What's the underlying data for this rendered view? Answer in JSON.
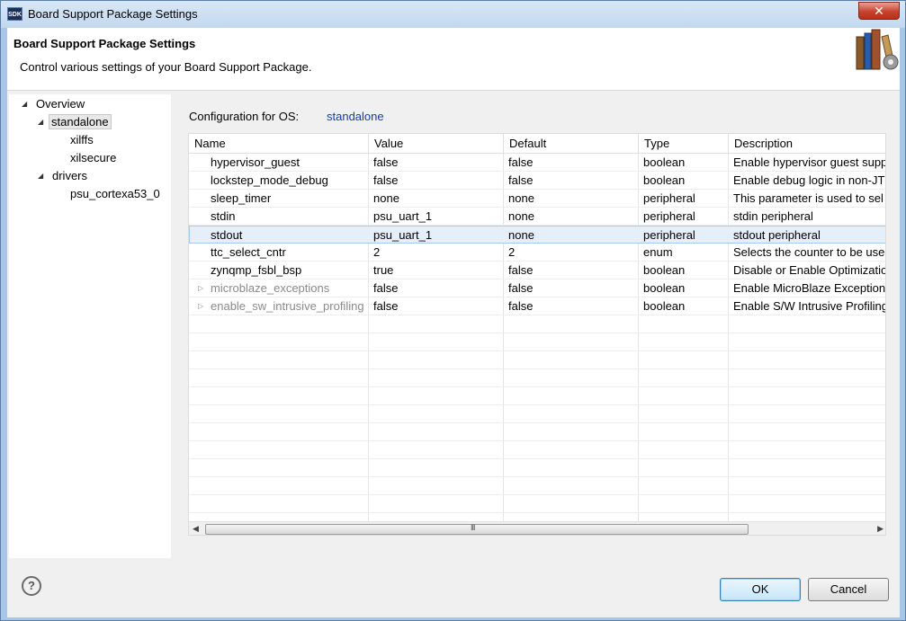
{
  "window": {
    "title": "Board Support Package Settings",
    "logo_text": "SDK"
  },
  "header": {
    "title": "Board Support Package Settings",
    "description": "Control various settings of your Board Support Package."
  },
  "tree": {
    "items": [
      {
        "label": "Overview",
        "expanded": true
      },
      {
        "label": "standalone",
        "expanded": true,
        "selected": true
      },
      {
        "label": "xilffs"
      },
      {
        "label": "xilsecure"
      },
      {
        "label": "drivers",
        "expanded": true
      },
      {
        "label": "psu_cortexa53_0"
      }
    ]
  },
  "config": {
    "label": "Configuration for OS:",
    "os": "standalone"
  },
  "table": {
    "columns": [
      "Name",
      "Value",
      "Default",
      "Type",
      "Description"
    ],
    "rows": [
      {
        "name": "hypervisor_guest",
        "value": "false",
        "default": "false",
        "type": "boolean",
        "description": "Enable hypervisor guest supp"
      },
      {
        "name": "lockstep_mode_debug",
        "value": "false",
        "default": "false",
        "type": "boolean",
        "description": "Enable debug logic in non-JT"
      },
      {
        "name": "sleep_timer",
        "value": "none",
        "default": "none",
        "type": "peripheral",
        "description": "This parameter is used to sel"
      },
      {
        "name": "stdin",
        "value": "psu_uart_1",
        "default": "none",
        "type": "peripheral",
        "description": "stdin peripheral"
      },
      {
        "name": "stdout",
        "value": "psu_uart_1",
        "default": "none",
        "type": "peripheral",
        "description": "stdout peripheral"
      },
      {
        "name": "ttc_select_cntr",
        "value": "2",
        "default": "2",
        "type": "enum",
        "description": "Selects the counter to be use"
      },
      {
        "name": "zynqmp_fsbl_bsp",
        "value": "true",
        "default": "false",
        "type": "boolean",
        "description": "Disable or Enable Optimizatio"
      },
      {
        "name": "microblaze_exceptions",
        "value": "false",
        "default": "false",
        "type": "boolean",
        "description": "Enable MicroBlaze Exceptions"
      },
      {
        "name": "enable_sw_intrusive_profiling",
        "value": "false",
        "default": "false",
        "type": "boolean",
        "description": "Enable S/W Intrusive Profiling"
      }
    ]
  },
  "buttons": {
    "ok": "OK",
    "cancel": "Cancel",
    "help": "?"
  },
  "scrollbar": {
    "grip": "III"
  }
}
